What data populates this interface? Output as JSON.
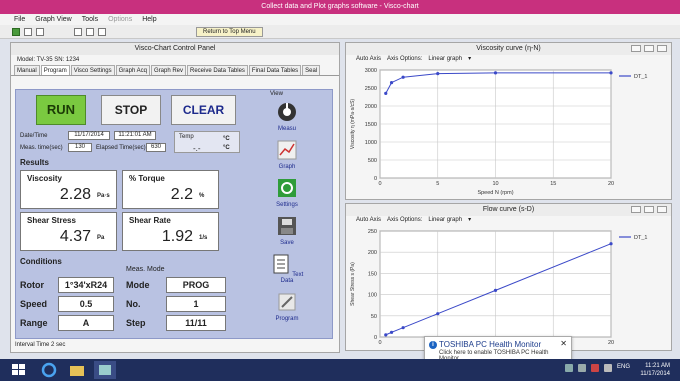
{
  "window": {
    "title": "Collect data and Plot graphs software - Visco-chart"
  },
  "menu": {
    "items": [
      "File",
      "Graph View",
      "Tools",
      "Options",
      "Help"
    ]
  },
  "toolbar": {
    "return_label": "Return to Top Menu"
  },
  "panel": {
    "title": "Visco-Chart Control Panel",
    "model_label": "Model: TV-35  SN: 1234",
    "tabs": [
      "Manual",
      "Program",
      "Visco Settings",
      "Graph Acq",
      "Graph Rev",
      "Receive Data Tables",
      "Final Data Tables",
      "Seal"
    ],
    "active_tab": "Program",
    "run": "RUN",
    "stop": "STOP",
    "clear": "CLEAR",
    "datetime_label": "Date/Time",
    "date": "11/17/2014",
    "time": "11:21:01 AM",
    "meas_time_label": "Meas. time(sec)",
    "meas_time": "130",
    "elapsed_label": "Elapsed Time(sec)",
    "elapsed": "630",
    "temp_label": "Temp",
    "temp_value": "-.-",
    "temp_unit": "°C",
    "results_label": "Results",
    "viscosity": {
      "title": "Viscosity",
      "value": "2.28",
      "unit": "Pa·s"
    },
    "torque": {
      "title": "% Torque",
      "value": "2.2",
      "unit": "%"
    },
    "shear_stress": {
      "title": "Shear Stress",
      "value": "4.37",
      "unit": "Pa"
    },
    "shear_rate": {
      "title": "Shear Rate",
      "value": "1.92",
      "unit": "1/s"
    },
    "conditions_label": "Conditions",
    "meas_mode_label": "Meas. Mode",
    "rotor_label": "Rotor",
    "rotor": "1°34'xR24",
    "speed_label": "Speed",
    "speed": "0.5",
    "range_label": "Range",
    "range": "A",
    "mode_label": "Mode",
    "mode": "PROG",
    "no_label": "No.",
    "no": "1",
    "step_label": "Step",
    "step": "11/11",
    "view_label": "View",
    "view_buttons": [
      "Measu",
      "Graph",
      "Settings",
      "Save",
      "Text Data",
      "Program"
    ],
    "status": "Interval Time 2 sec"
  },
  "chart_windows": [
    {
      "title": "Viscosity curve (η-N)",
      "auto_axis": "Auto Axis",
      "axis_options": "Axis Options:",
      "graph_type": "Linear graph"
    },
    {
      "title": "Flow curve (s-D)",
      "auto_axis": "Auto Axis",
      "axis_options": "Axis Options:",
      "graph_type": "Linear graph"
    }
  ],
  "chart_data": [
    {
      "type": "line",
      "title": "Viscosity curve (η-N)",
      "xlabel": "Speed N (rpm)",
      "ylabel": "Viscosity η (mPa·s/cS)",
      "xlim": [
        0,
        20
      ],
      "ylim": [
        0,
        3000
      ],
      "xticks": [
        0,
        5,
        10,
        15,
        20
      ],
      "yticks": [
        0,
        500,
        1000,
        1500,
        2000,
        2500,
        3000
      ],
      "legend": "top-right",
      "color": "#3b49c8",
      "series": [
        {
          "name": "DT_1",
          "x": [
            0.5,
            1,
            2,
            5,
            10,
            20
          ],
          "y": [
            2350,
            2650,
            2800,
            2900,
            2920,
            2920
          ]
        }
      ]
    },
    {
      "type": "line",
      "title": "Flow curve (s-D)",
      "xlabel": "",
      "ylabel": "Shear Stress s (Pa)",
      "xlim": [
        0,
        20
      ],
      "ylim": [
        0,
        250
      ],
      "xticks": [
        0,
        5,
        10,
        15,
        20
      ],
      "yticks": [
        0,
        50,
        100,
        150,
        200,
        250
      ],
      "legend": "top-right",
      "color": "#3b49c8",
      "series": [
        {
          "name": "DT_1",
          "x": [
            0.5,
            1,
            2,
            5,
            10,
            20
          ],
          "y": [
            5,
            11,
            22,
            55,
            110,
            220
          ]
        }
      ]
    }
  ],
  "notification": {
    "title": "TOSHIBA PC Health Monitor",
    "subtitle": "Click here to enable TOSHIBA PC Health Monitor."
  },
  "taskbar": {
    "time": "11:21 AM",
    "date": "11/17/2014",
    "lang": "ENG"
  }
}
